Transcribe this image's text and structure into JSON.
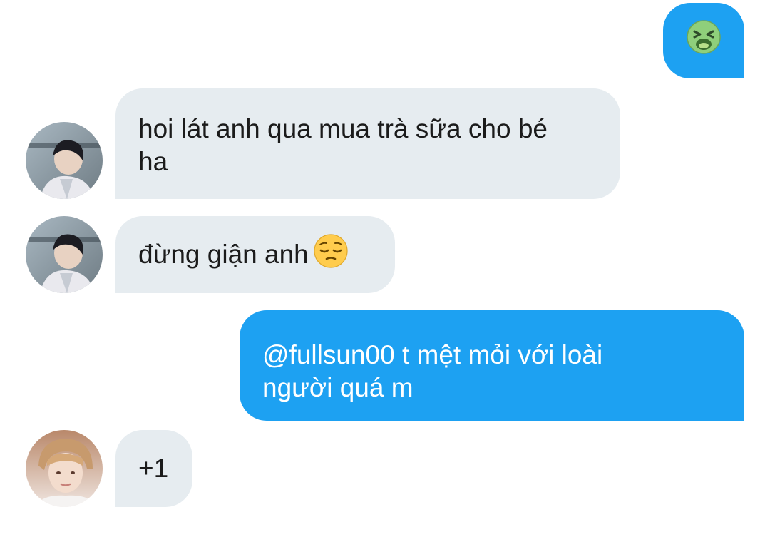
{
  "conversation": {
    "messages": [
      {
        "direction": "outgoing",
        "text": "",
        "emoji": "nauseated-face"
      },
      {
        "direction": "incoming",
        "text": "hoi lát anh qua mua trà sữa cho bé ha",
        "line1": "hoi lát anh qua mua trà sữa cho bé",
        "line2": "ha"
      },
      {
        "direction": "incoming",
        "text": "đừng giận anh",
        "emoji": "pensive-face"
      },
      {
        "direction": "outgoing",
        "text": "@fullsun00 t mệt mỏi với loài người quá m",
        "line1": "@fullsun00 t mệt mỏi với loài",
        "line2": "người quá m"
      },
      {
        "direction": "incoming",
        "text": "+1"
      }
    ]
  },
  "colors": {
    "incoming_bubble": "#e6ecf0",
    "outgoing_bubble": "#1da1f2",
    "background": "#ffffff"
  }
}
